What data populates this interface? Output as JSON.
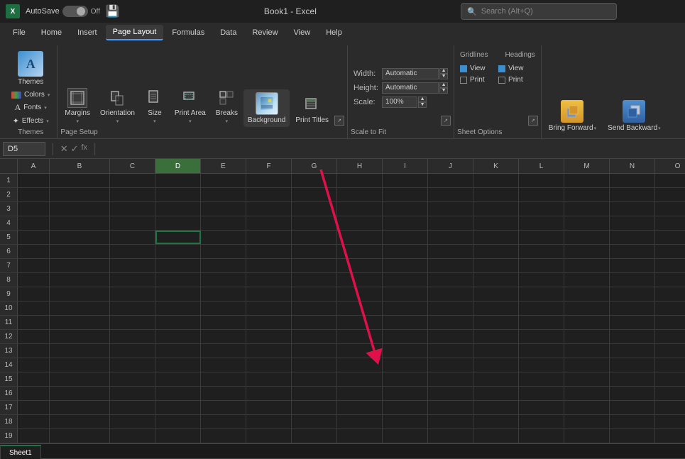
{
  "titleBar": {
    "logo": "X",
    "autosave_label": "AutoSave",
    "toggle_state": "Off",
    "save_icon": "💾",
    "title": "Book1 - Excel",
    "search_placeholder": "Search (Alt+Q)"
  },
  "menuBar": {
    "items": [
      {
        "id": "file",
        "label": "File"
      },
      {
        "id": "home",
        "label": "Home"
      },
      {
        "id": "insert",
        "label": "Insert"
      },
      {
        "id": "page-layout",
        "label": "Page Layout",
        "active": true
      },
      {
        "id": "formulas",
        "label": "Formulas"
      },
      {
        "id": "data",
        "label": "Data"
      },
      {
        "id": "review",
        "label": "Review"
      },
      {
        "id": "view",
        "label": "View"
      },
      {
        "id": "help",
        "label": "Help"
      }
    ]
  },
  "ribbon": {
    "groups": [
      {
        "id": "themes",
        "label": "Themes",
        "items": [
          {
            "id": "themes-btn",
            "label": "Themes",
            "type": "big"
          },
          {
            "id": "colors-btn",
            "label": "Colors ▾",
            "type": "small"
          },
          {
            "id": "fonts-btn",
            "label": "Fonts ▾",
            "type": "small"
          },
          {
            "id": "effects-btn",
            "label": "Effects ▾",
            "type": "small"
          }
        ]
      },
      {
        "id": "page-setup",
        "label": "Page Setup",
        "items": [
          {
            "id": "margins-btn",
            "label": "Margins",
            "type": "big"
          },
          {
            "id": "orientation-btn",
            "label": "Orientation",
            "type": "big"
          },
          {
            "id": "size-btn",
            "label": "Size",
            "type": "big"
          },
          {
            "id": "print-area-btn",
            "label": "Print Area",
            "type": "big"
          },
          {
            "id": "breaks-btn",
            "label": "Breaks",
            "type": "big"
          },
          {
            "id": "background-btn",
            "label": "Background",
            "type": "big"
          },
          {
            "id": "print-titles-btn",
            "label": "Print Titles",
            "type": "big"
          }
        ]
      },
      {
        "id": "scale-to-fit",
        "label": "Scale to Fit",
        "width_label": "Width:",
        "height_label": "Height:",
        "scale_label": "Scale:",
        "width_value": "Automatic",
        "height_value": "Automatic",
        "scale_value": "100%"
      },
      {
        "id": "sheet-options",
        "label": "Sheet Options",
        "gridlines_label": "Gridlines",
        "headings_label": "Headings",
        "view_label": "View",
        "print_label": "Print",
        "gridlines_view_checked": true,
        "gridlines_print_checked": false,
        "headings_view_checked": true,
        "headings_print_checked": false
      },
      {
        "id": "arrange",
        "label": "",
        "items": [
          {
            "id": "bring-forward-btn",
            "label": "Bring Forward",
            "type": "big"
          },
          {
            "id": "send-backward-btn",
            "label": "Send Backward",
            "type": "big"
          }
        ]
      }
    ]
  },
  "formulaBar": {
    "cell_ref": "D5",
    "formula": ""
  },
  "spreadsheet": {
    "columns": [
      "A",
      "B",
      "C",
      "D",
      "E",
      "F",
      "G",
      "H",
      "I",
      "J",
      "K",
      "L",
      "M",
      "N",
      "O"
    ],
    "selected_cell": "D5",
    "selected_col": "D",
    "rows": 19
  },
  "sheetTabs": {
    "tabs": [
      {
        "label": "Sheet1",
        "active": true
      }
    ]
  },
  "arrow": {
    "color": "#e0104a",
    "from": "background-button",
    "to": "spreadsheet"
  }
}
